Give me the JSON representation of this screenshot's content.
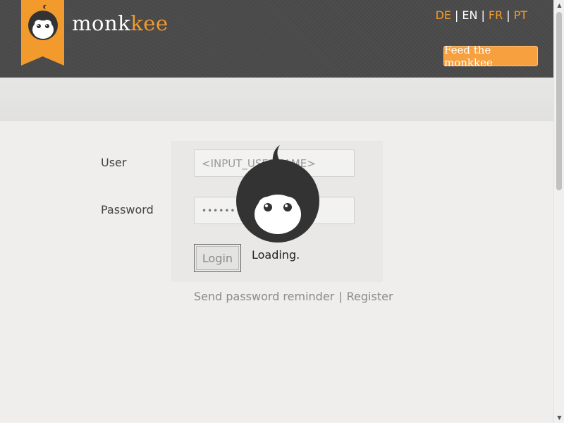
{
  "header": {
    "logo_prefix": "monk",
    "logo_suffix": "kee",
    "languages": [
      {
        "code": "DE",
        "active": false
      },
      {
        "code": "EN",
        "active": true
      },
      {
        "code": "FR",
        "active": false
      },
      {
        "code": "PT",
        "active": false
      }
    ],
    "language_separator": "|",
    "feed_button": "Feed the monkkee"
  },
  "form": {
    "user_label": "User",
    "password_label": "Password",
    "user_value": "<INPUT_USERNAME>",
    "password_value": "••••••••••",
    "login_button": "Login"
  },
  "links": {
    "reminder": "Send password reminder",
    "separator": "|",
    "register": "Register"
  },
  "loading": {
    "text": "Loading."
  },
  "colors": {
    "accent": "#f39a2c",
    "header_bg": "#4a4a4a",
    "page_bg": "#efeeec"
  },
  "icons": {
    "logo": "monkey-face-icon",
    "loader": "monkey-face-icon",
    "scroll_up": "triangle-up-icon",
    "scroll_down": "triangle-down-icon"
  }
}
